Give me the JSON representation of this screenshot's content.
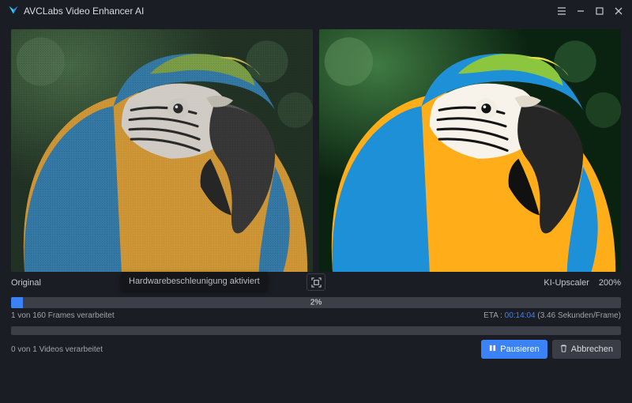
{
  "app": {
    "title": "AVCLabs Video Enhancer AI"
  },
  "labels": {
    "original": "Original",
    "upscaler": "KI-Upscaler",
    "zoom": "200%",
    "tooltip": "Hardwarebeschleunigung aktiviert"
  },
  "progress": {
    "percent_text": "2%",
    "percent_value": 2,
    "frames_text": "1 von 160 Frames verarbeitet",
    "eta_label": "ETA :",
    "eta_time": "00:14:04",
    "eta_detail": "(3.46 Sekunden/Frame)",
    "videos_text": "0 von 1 Videos verarbeitet"
  },
  "buttons": {
    "pause": "Pausieren",
    "cancel": "Abbrechen"
  }
}
